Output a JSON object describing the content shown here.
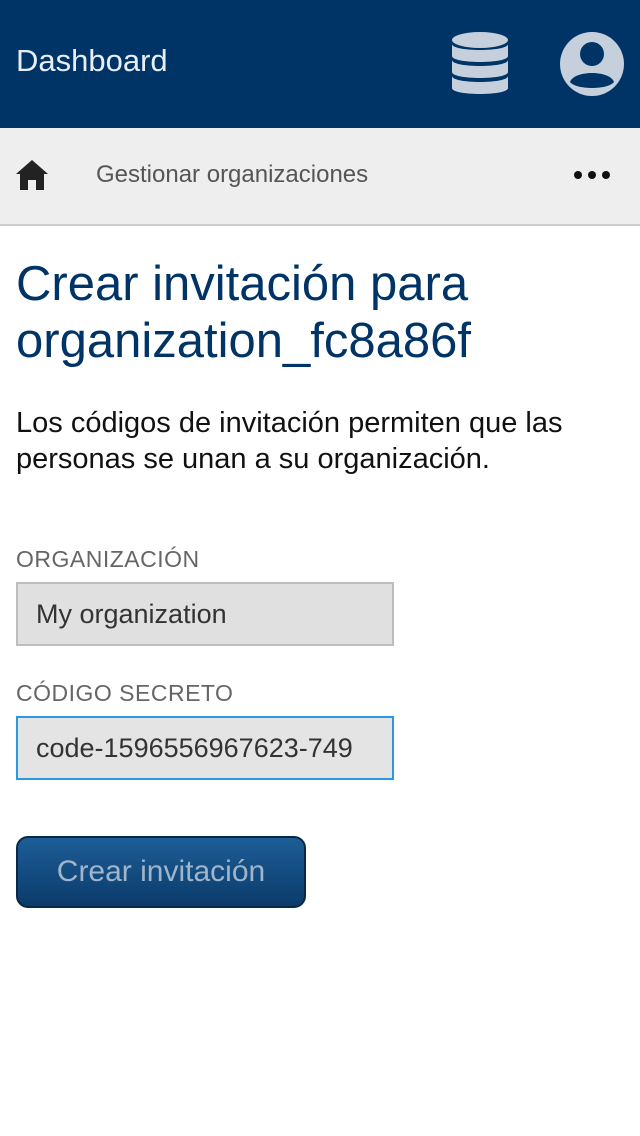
{
  "header": {
    "title": "Dashboard",
    "database_icon": "database-icon",
    "account_icon": "account-circle-icon"
  },
  "nav": {
    "home_icon": "home-icon",
    "breadcrumb": "Gestionar organizaciones",
    "more_icon": "more-horizontal-icon"
  },
  "main": {
    "title": "Crear invitación para organization_fc8a86f",
    "intro": "Los códigos de invitación permiten que las personas se unan a su organización."
  },
  "form": {
    "org_label": "ORGANIZACIÓN",
    "org_value": "My organization",
    "code_label": "CÓDIGO SECRETO",
    "code_value": "code-1596556967623-749",
    "submit_label": "Crear invitación"
  },
  "colors": {
    "brand": "#003366",
    "nav_bg": "#eeeeee",
    "focus": "#2a9ae0"
  }
}
